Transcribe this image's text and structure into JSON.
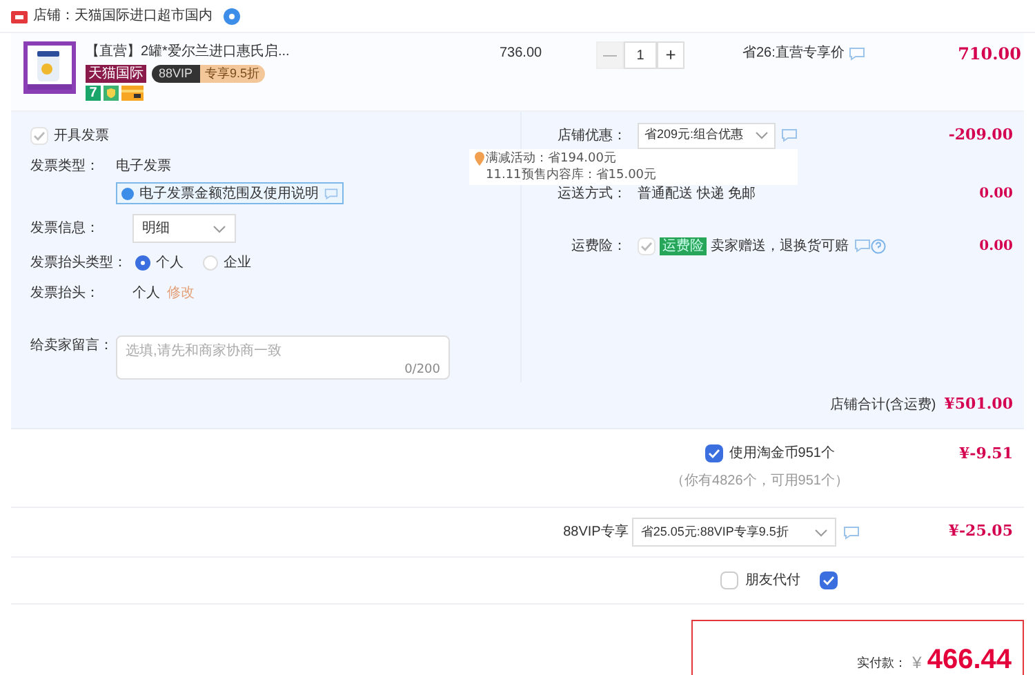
{
  "shop": {
    "label": "店铺：",
    "name": "天猫国际进口超市国内"
  },
  "item": {
    "title": "【直营】2罐*爱尔兰进口惠氏启...",
    "tags": [
      {
        "kind": "brand",
        "text": "天猫国际"
      },
      {
        "kind": "vip",
        "text": "88VIP",
        "extra": "专享9.5折"
      }
    ],
    "badges": [
      {
        "kind": "number",
        "text": "7"
      },
      {
        "kind": "shield"
      },
      {
        "kind": "card"
      }
    ],
    "unit_price": "736.00",
    "minus": "—",
    "quantity": "1",
    "plus": "+",
    "discount": "省26:直营专享价",
    "price": "710.00"
  },
  "invoice": {
    "checked": true,
    "label": "开具发票",
    "type_label": "发票类型：",
    "type_value": "电子发票",
    "note": "电子发票金额范围及使用说明",
    "info_label": "发票信息：",
    "info_value": "明细",
    "header_type_label": "发票抬头类型：",
    "header_types": [
      {
        "label": "个人",
        "selected": true
      },
      {
        "label": "企业",
        "selected": false
      }
    ],
    "header_label": "发票抬头：",
    "header_value": "个人",
    "edit_link": "修改"
  },
  "message": {
    "label": "给卖家留言：",
    "placeholder": "选填,请先和商家协商一致",
    "counter": "0/200"
  },
  "store_discount": {
    "label": "店铺优惠：",
    "value": "省209元:组合优惠",
    "amount": "-209.00"
  },
  "tooltip": {
    "lines": [
      "满减活动：省194.00元",
      "11.11预售内容库：省15.00元"
    ]
  },
  "shipping": {
    "label": "运送方式：",
    "value": "普通配送 快递 免邮",
    "amount": "0.00"
  },
  "insurance": {
    "label": "运费险：",
    "checked": true,
    "badge": "运费险",
    "text": "卖家赠送，退换货可赔",
    "amount": "0.00"
  },
  "store_total": {
    "label": "店铺合计(含运费)",
    "amount": "¥501.00"
  },
  "coins": {
    "checked": true,
    "label": "使用淘金币951个",
    "note": "（你有4826个，可用951个）",
    "amount": "¥-9.51"
  },
  "vip": {
    "label": "88VIP专享",
    "value": "省25.05元:88VIP专享9.5折",
    "amount": "¥-25.05"
  },
  "options": [
    {
      "label": "朋友代付",
      "checked": false
    },
    {
      "checked": true
    }
  ],
  "payment": {
    "label": "实付款：",
    "currency": "¥",
    "amount": "466.44"
  }
}
